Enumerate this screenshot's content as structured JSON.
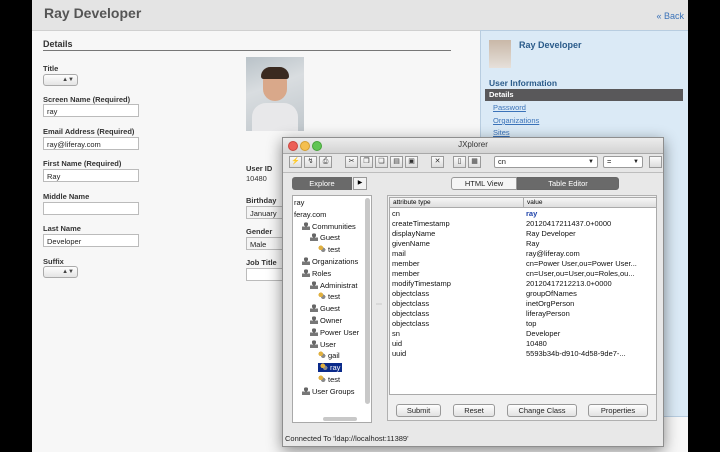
{
  "portal": {
    "title": "Ray Developer",
    "back_link": "« Back",
    "details_heading": "Details",
    "fields": [
      {
        "label": "Title",
        "value": "",
        "kind": "select"
      },
      {
        "label": "Screen Name (Required)",
        "value": "ray",
        "kind": "input"
      },
      {
        "label": "Email Address (Required)",
        "value": "ray@liferay.com",
        "kind": "input"
      },
      {
        "label": "First Name (Required)",
        "value": "Ray",
        "kind": "input"
      },
      {
        "label": "Middle Name",
        "value": "",
        "kind": "input"
      },
      {
        "label": "Last Name",
        "value": "Developer",
        "kind": "input"
      },
      {
        "label": "Suffix",
        "value": "",
        "kind": "select"
      }
    ],
    "user_id_label": "User ID",
    "user_id_value": "10480",
    "birthday_label": "Birthday",
    "birthday_value": "January",
    "gender_label": "Gender",
    "gender_value": "Male",
    "job_title_label": "Job Title"
  },
  "right_panel": {
    "user_name": "Ray Developer",
    "section": "User Information",
    "active_nav": "Details",
    "links": [
      "Password",
      "Organizations",
      "Sites"
    ]
  },
  "jxplorer": {
    "title": "JXplorer",
    "attr_combo": "cn",
    "op_combo": "=",
    "explore_tab": "Explore",
    "html_view_tab": "HTML View",
    "table_editor_tab": "Table Editor",
    "tree": [
      {
        "text": "ray",
        "indent": 0,
        "icon": "none"
      },
      {
        "text": "feray.com",
        "indent": 0,
        "icon": "none"
      },
      {
        "text": "Communities",
        "indent": 1,
        "icon": "group"
      },
      {
        "text": "Guest",
        "indent": 2,
        "icon": "group"
      },
      {
        "text": "test",
        "indent": 3,
        "icon": "user"
      },
      {
        "text": "Organizations",
        "indent": 1,
        "icon": "group"
      },
      {
        "text": "Roles",
        "indent": 1,
        "icon": "group"
      },
      {
        "text": "Administrat",
        "indent": 2,
        "icon": "group"
      },
      {
        "text": "test",
        "indent": 3,
        "icon": "user"
      },
      {
        "text": "Guest",
        "indent": 2,
        "icon": "group"
      },
      {
        "text": "Owner",
        "indent": 2,
        "icon": "group"
      },
      {
        "text": "Power User",
        "indent": 2,
        "icon": "group"
      },
      {
        "text": "User",
        "indent": 2,
        "icon": "group"
      },
      {
        "text": "gail",
        "indent": 3,
        "icon": "user"
      },
      {
        "text": "ray",
        "indent": 3,
        "icon": "user",
        "selected": true
      },
      {
        "text": "test",
        "indent": 3,
        "icon": "user"
      },
      {
        "text": "User Groups",
        "indent": 1,
        "icon": "group"
      }
    ],
    "table_header": {
      "attribute": "attribute type",
      "value": "value"
    },
    "rows": [
      {
        "attr": "cn",
        "value": "ray",
        "highlight": true
      },
      {
        "attr": "createTimestamp",
        "value": "20120417211437.0+0000"
      },
      {
        "attr": "displayName",
        "value": "Ray Developer"
      },
      {
        "attr": "givenName",
        "value": "Ray"
      },
      {
        "attr": "mail",
        "value": "ray@liferay.com"
      },
      {
        "attr": "member",
        "value": "cn=Power User,ou=Power User..."
      },
      {
        "attr": "member",
        "value": "cn=User,ou=User,ou=Roles,ou..."
      },
      {
        "attr": "modifyTimestamp",
        "value": "20120417212213.0+0000"
      },
      {
        "attr": "objectclass",
        "value": "groupOfNames"
      },
      {
        "attr": "objectclass",
        "value": "inetOrgPerson"
      },
      {
        "attr": "objectclass",
        "value": "liferayPerson"
      },
      {
        "attr": "objectclass",
        "value": "top"
      },
      {
        "attr": "sn",
        "value": "Developer"
      },
      {
        "attr": "uid",
        "value": "10480"
      },
      {
        "attr": "uuid",
        "value": "5593b34b-d910-4d58-9de7-..."
      }
    ],
    "buttons": {
      "submit": "Submit",
      "reset": "Reset",
      "change_class": "Change Class",
      "properties": "Properties"
    },
    "status": "Connected To 'ldap://localhost:11389'"
  },
  "colors": {
    "accent": "#3b73b9",
    "selection": "#0a2a8a",
    "panel_bg": "#dbeaf6"
  }
}
